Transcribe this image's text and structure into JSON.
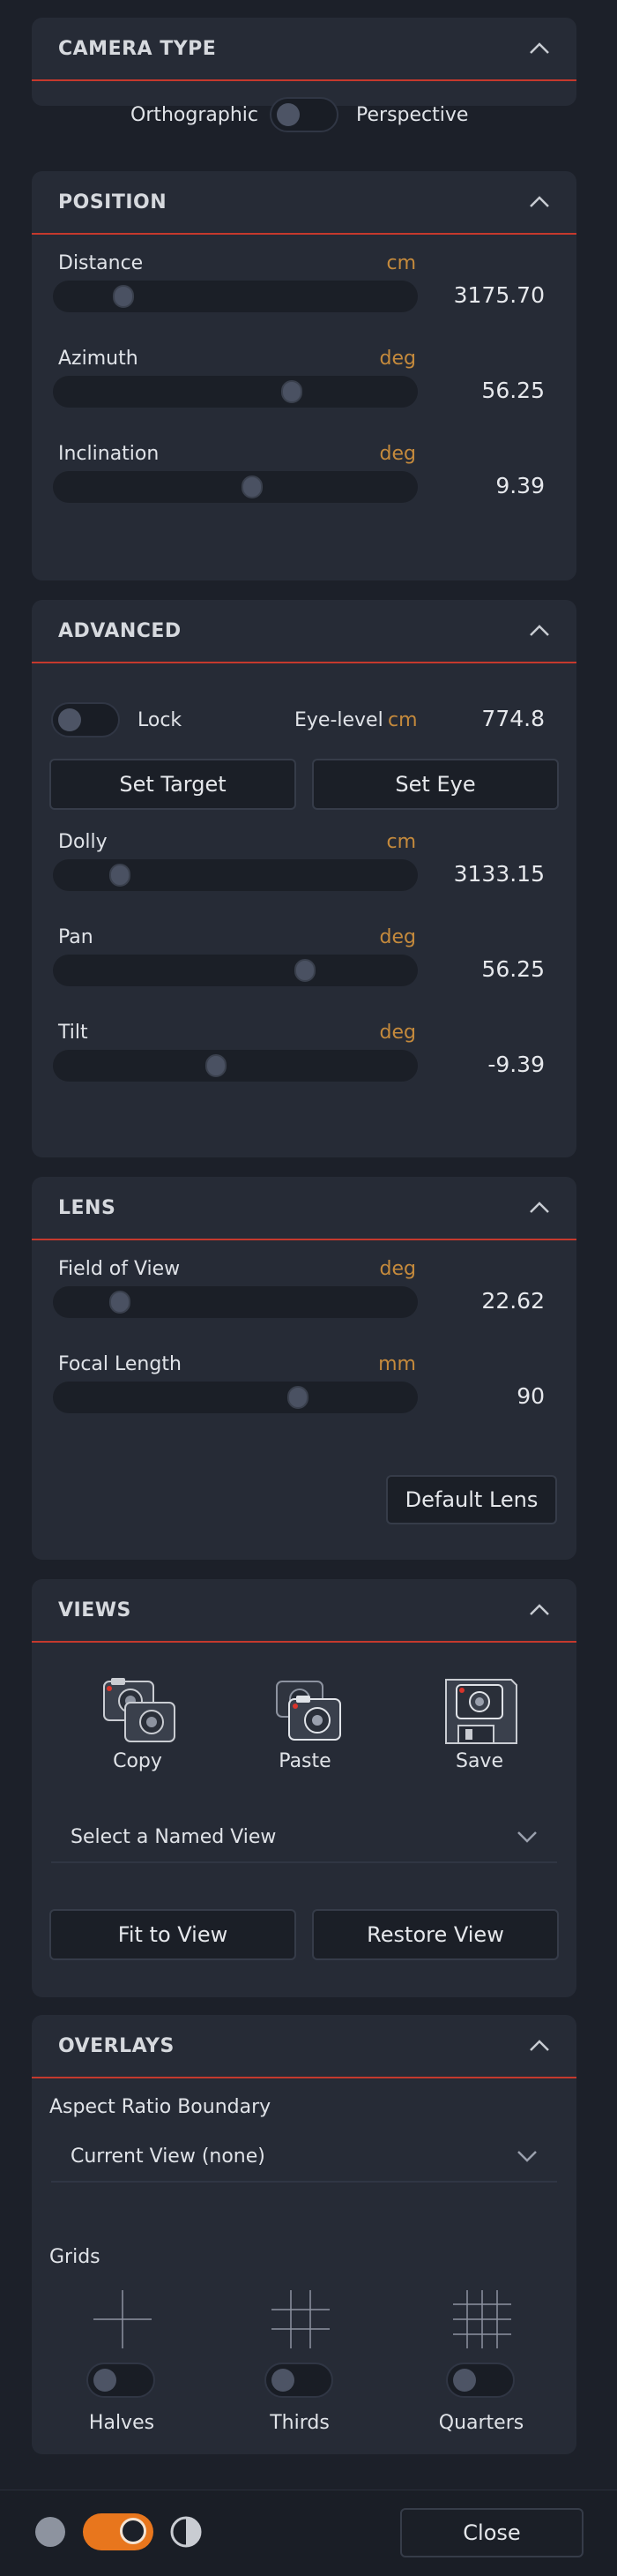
{
  "camera_type": {
    "title": "CAMERA TYPE",
    "left_label": "Orthographic",
    "right_label": "Perspective"
  },
  "position": {
    "title": "POSITION",
    "sliders": [
      {
        "label": "Distance",
        "unit": "cm",
        "value": "3175.70",
        "level": 0.16
      },
      {
        "label": "Azimuth",
        "unit": "deg",
        "value": "56.25",
        "level": 0.67
      },
      {
        "label": "Inclination",
        "unit": "deg",
        "value": "9.39",
        "level": 0.55
      }
    ]
  },
  "advanced": {
    "title": "ADVANCED",
    "lock_label": "Lock",
    "eye_level_label": "Eye-level",
    "eye_level_unit": "cm",
    "eye_level_value": "774.8",
    "set_target": "Set Target",
    "set_eye": "Set Eye",
    "sliders": [
      {
        "label": "Dolly",
        "unit": "cm",
        "value": "3133.15",
        "level": 0.15
      },
      {
        "label": "Pan",
        "unit": "deg",
        "value": "56.25",
        "level": 0.71
      },
      {
        "label": "Tilt",
        "unit": "deg",
        "value": "-9.39",
        "level": 0.44
      }
    ]
  },
  "lens": {
    "title": "LENS",
    "sliders": [
      {
        "label": "Field of View",
        "unit": "deg",
        "value": "22.62",
        "level": 0.15
      },
      {
        "label": "Focal Length",
        "unit": "mm",
        "value": "90",
        "level": 0.69
      }
    ],
    "default_button": "Default Lens"
  },
  "views": {
    "title": "VIEWS",
    "copy": "Copy",
    "paste": "Paste",
    "save": "Save",
    "select_placeholder": "Select a Named View",
    "fit_button": "Fit to View",
    "restore_button": "Restore View"
  },
  "overlays": {
    "title": "OVERLAYS",
    "aspect_label": "Aspect Ratio Boundary",
    "aspect_value": "Current View (none)",
    "grids_label": "Grids",
    "grids": [
      "Halves",
      "Thirds",
      "Quarters"
    ]
  },
  "footer": {
    "close": "Close",
    "accent": "#e8761d"
  },
  "colors": {
    "header_rule": "#c5392d",
    "unit": "#c58a3c",
    "camera_red": "#d9342b"
  }
}
